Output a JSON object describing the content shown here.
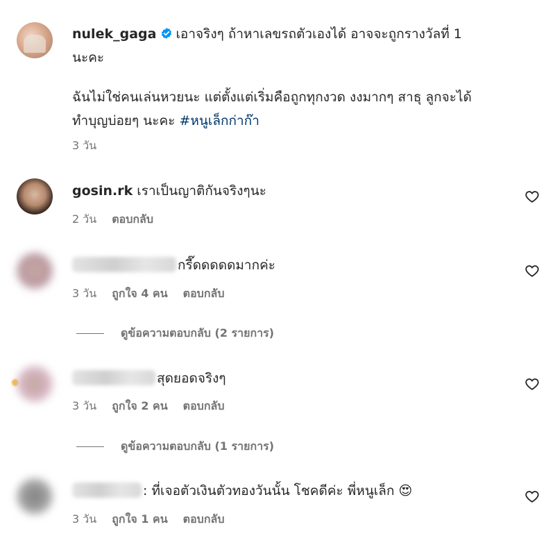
{
  "comments": [
    {
      "username": "nulek_gaga",
      "text_line1": "เอาจริงๆ ถ้าหาเลขรถตัวเองได้ อาจจะถูกรางวัลที่ 1",
      "text_line2": "นะคะ",
      "text_line3": "ฉันไม่ใช่คนเล่นหวยนะ แต่ตั้งแต่เริ่มคือถูกทุกงวด งงมากๆ สาธุ ลูกจะได้",
      "text_line4": "ทำบุญบ่อยๆ นะคะ",
      "hashtag": "#หนูเล็กก่าก๊า",
      "time": "3 วัน"
    },
    {
      "username": "gosin.rk",
      "text": "เราเป็นญาติกันจริงๆนะ",
      "time": "2 วัน",
      "reply": "ตอบกลับ"
    },
    {
      "text": "กรี๊ดดดดดมากค่ะ",
      "time": "3 วัน",
      "likes": "ถูกใจ 4 คน",
      "reply": "ตอบกลับ",
      "view_replies": "ดูข้อความตอบกลับ (2 รายการ)"
    },
    {
      "text": "สุดยอดจริงๆ",
      "time": "3 วัน",
      "likes": "ถูกใจ 2 คน",
      "reply": "ตอบกลับ",
      "view_replies": "ดูข้อความตอบกลับ (1 รายการ)"
    },
    {
      "text": ": ที่เจอตัวเงินตัวทองวันนั้น โชคดีค่ะ พี่หนูเล็ก 😍",
      "time": "3 วัน",
      "likes": "ถูกใจ 1 คน",
      "reply": "ตอบกลับ"
    }
  ],
  "icons": {
    "verified": "verified-badge-icon",
    "like": "heart-outline-icon"
  },
  "colors": {
    "verified": "#0095f6",
    "hashtag": "#00376b",
    "meta_text": "#737373"
  }
}
